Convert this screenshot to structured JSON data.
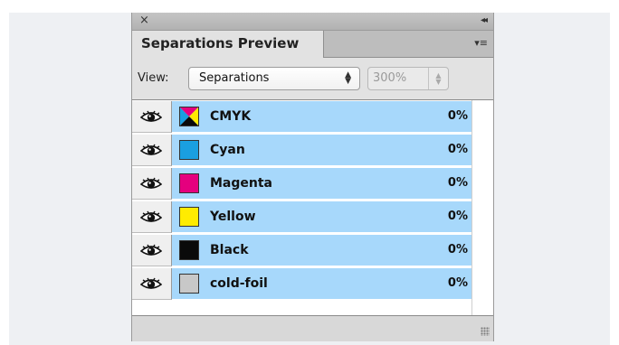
{
  "panel": {
    "close_glyph": "×",
    "collapse_glyph": "◂◂",
    "menu_glyph": "▾≡",
    "tab_title": "Separations Preview"
  },
  "controls": {
    "view_label": "View:",
    "view_value": "Separations",
    "zoom_value": "300%"
  },
  "inks": [
    {
      "name": "CMYK",
      "percent": "0%",
      "swatch": "cmyk"
    },
    {
      "name": "Cyan",
      "percent": "0%",
      "swatch": "#1a9fe0"
    },
    {
      "name": "Magenta",
      "percent": "0%",
      "swatch": "#e5007e"
    },
    {
      "name": "Yellow",
      "percent": "0%",
      "swatch": "#ffec00"
    },
    {
      "name": "Black",
      "percent": "0%",
      "swatch": "#0a0a0a"
    },
    {
      "name": "cold-foil",
      "percent": "0%",
      "swatch": "#c8c8c8"
    }
  ],
  "colors": {
    "row_highlight": "#a7d8fb",
    "panel_bg": "#d6d6d6"
  }
}
